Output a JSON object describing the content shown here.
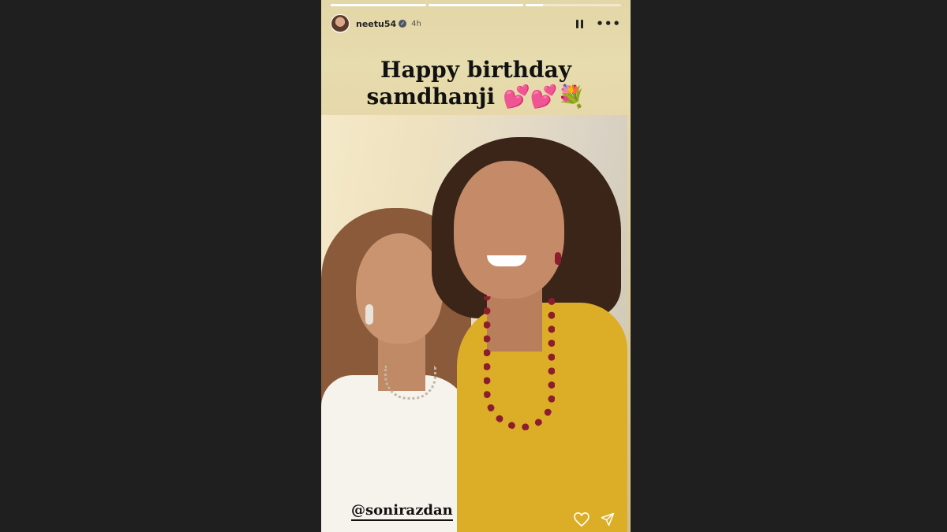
{
  "story": {
    "progress": [
      1,
      1,
      0.18
    ],
    "username": "neetu54",
    "time": "4h",
    "caption_line1": "Happy birthday",
    "caption_line2": "samdhanji 💕💕💐",
    "mention": "@sonirazdan"
  },
  "icons": {
    "verified": "verified-badge-icon",
    "pause": "pause-icon",
    "more": "more-options-icon",
    "like": "heart-icon",
    "share": "send-icon"
  },
  "colors": {
    "background": "#1f1f1f",
    "story_bg": "#e3d6a7",
    "text": "#111111"
  }
}
